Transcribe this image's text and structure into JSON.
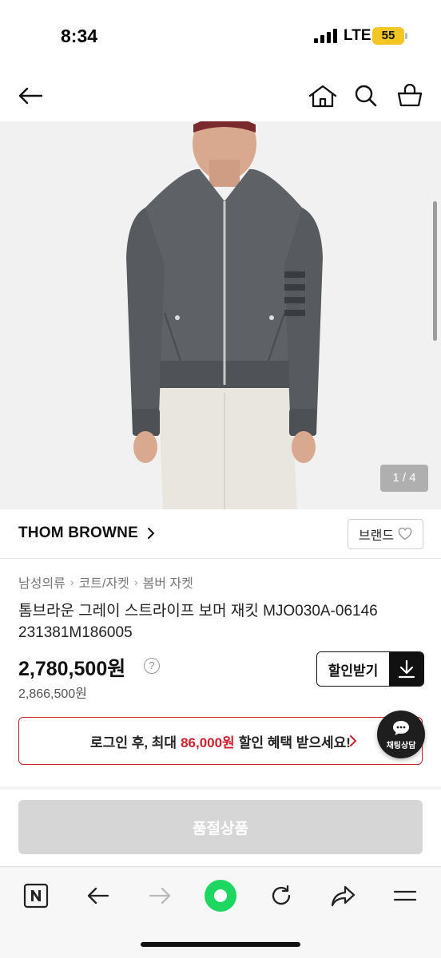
{
  "status_bar": {
    "time": "8:34",
    "network": "LTE",
    "battery": "55"
  },
  "nav": {
    "back_icon": "back-arrow-icon",
    "home_icon": "home-icon",
    "search_icon": "search-icon",
    "cart_icon": "basket-icon"
  },
  "gallery": {
    "counter": "1 / 4"
  },
  "brand": {
    "name": "THOM BROWNE",
    "button_label": "브랜드"
  },
  "breadcrumb": [
    "남성의류",
    "코트/자켓",
    "봄버 자켓"
  ],
  "product": {
    "title_line1": "톰브라운 그레이 스트라이프 보머 재킷 MJO030A-06146",
    "title_line2": "231381M186005",
    "price": "2,780,500원",
    "original_price": "2,866,500원",
    "help": "?"
  },
  "coupon": {
    "label": "할인받기"
  },
  "login_banner": {
    "prefix": "로그인 후, 최대",
    "amount": "86,000원",
    "suffix": "할인 혜택 받으세요!"
  },
  "chat": {
    "label": "채팅상담"
  },
  "soldout": {
    "label": "품절상품"
  },
  "colors": {
    "accent_red": "#d0202f",
    "battery": "#f3c623",
    "reload_green": "#1ed760",
    "soldout_gray": "#d6d6d6"
  },
  "toolbar": {
    "items": [
      "naver-icon",
      "back-icon",
      "forward-icon",
      "reload-icon",
      "refresh-icon",
      "share-icon",
      "menu-icon"
    ]
  }
}
